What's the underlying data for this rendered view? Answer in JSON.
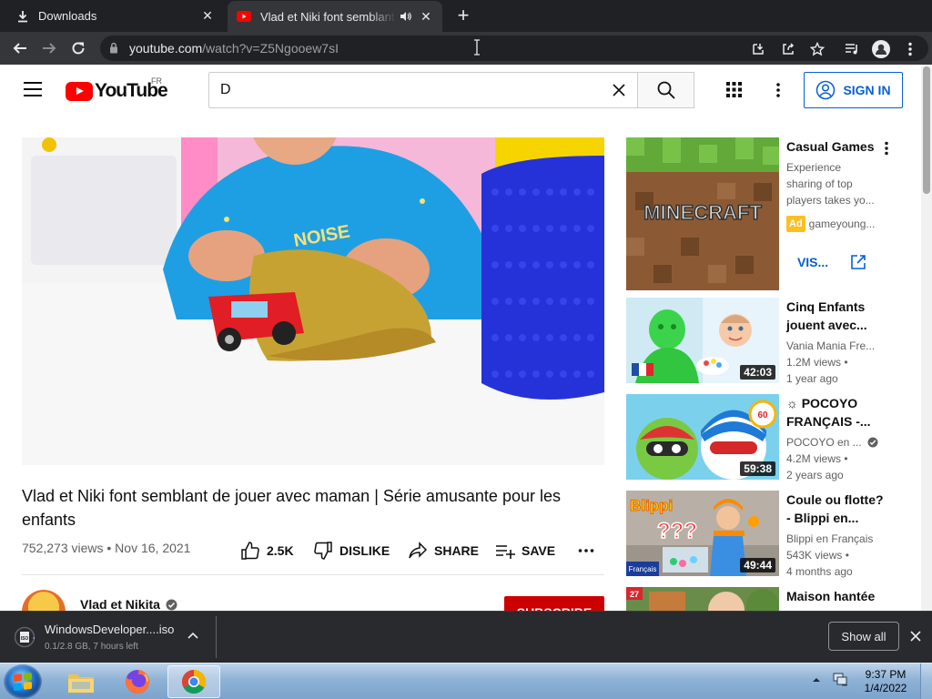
{
  "browser": {
    "tabs": [
      {
        "title": "Downloads",
        "icon": "download-icon"
      },
      {
        "title": "Vlad et Niki font semblant de jouer avec maman",
        "icon": "youtube-favicon",
        "audio": true
      }
    ],
    "url_host": "youtube.com",
    "url_path": "/watch?v=Z5Ngooew7sI"
  },
  "youtube": {
    "logo_text": "YouTube",
    "country_code": "FR",
    "search_value": "D",
    "sign_in": "SIGN IN"
  },
  "video": {
    "title": "Vlad et Niki font semblant de jouer avec maman | Série amusante pour les enfants",
    "meta": "752,273 views • Nov 16, 2021",
    "likes": "2.5K",
    "dislike": "DISLIKE",
    "share": "SHARE",
    "save": "SAVE",
    "channel": "Vlad et Nikita",
    "subscribe": "SUBSCRIBE"
  },
  "sidebar": {
    "ad": {
      "title": "Casual Games",
      "desc1": "Experience",
      "desc2": "sharing of top",
      "desc3": "players takes yo...",
      "badge": "Ad",
      "advertiser": "gameyoung...",
      "visit": "VIS...",
      "thumb_text": "MINECRAFT"
    },
    "videos": [
      {
        "title1": "Cinq Enfants",
        "title2": "jouent avec...",
        "channel": "Vania Mania Fre...",
        "views": "1.2M views •",
        "age": "1 year ago",
        "duration": "42:03"
      },
      {
        "title1": "☼ POCOYO",
        "title2": "FRANÇAIS -...",
        "channel": "POCOYO en ...",
        "views": "4.2M views •",
        "age": "2 years ago",
        "duration": "59:38",
        "thumb_badge": "60"
      },
      {
        "title1": "Coule ou flotte?",
        "title2": "- Blippi en...",
        "channel": "Blippi en Français",
        "views": "543K views •",
        "age": "4 months ago",
        "duration": "49:44",
        "thumb_text": "Blippi",
        "thumb_tag": "Français"
      },
      {
        "title1": "Maison hantée",
        "thumb_tag": "27"
      }
    ]
  },
  "downloads": {
    "file": "WindowsDeveloper....iso",
    "status": "0.1/2.8 GB, 7 hours left",
    "show_all": "Show all"
  },
  "taskbar": {
    "time": "9:37 PM",
    "date": "1/4/2022"
  },
  "colors": {
    "youtube_red": "#ff0000",
    "link_blue": "#065fd4",
    "chrome_dark": "#202124"
  }
}
